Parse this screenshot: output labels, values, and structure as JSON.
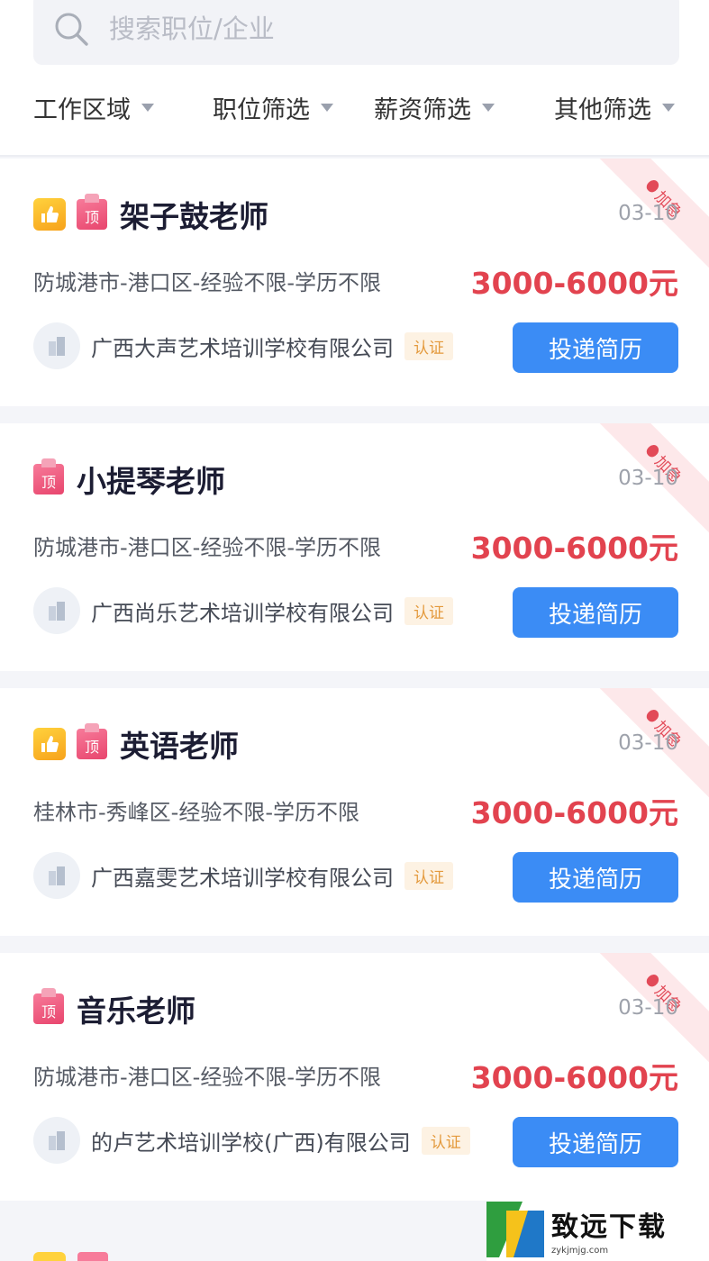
{
  "search": {
    "placeholder": "搜索职位/企业"
  },
  "filters": [
    {
      "label": "工作区域"
    },
    {
      "label": "职位筛选"
    },
    {
      "label": "薪资筛选"
    },
    {
      "label": "其他筛选"
    }
  ],
  "jobs": [
    {
      "title": "架子鼓老师",
      "date": "03-10",
      "location": "防城港市-港口区-经验不限-学历不限",
      "salary": "3000-6000元",
      "company": "广西大声艺术培训学校有限公司",
      "cert": "认证",
      "apply": "投递简历",
      "ribbon": "加急"
    },
    {
      "title": "小提琴老师",
      "date": "03-10",
      "location": "防城港市-港口区-经验不限-学历不限",
      "salary": "3000-6000元",
      "company": "广西尚乐艺术培训学校有限公司",
      "cert": "认证",
      "apply": "投递简历",
      "ribbon": "加急"
    },
    {
      "title": "英语老师",
      "date": "03-10",
      "location": "桂林市-秀峰区-经验不限-学历不限",
      "salary": "3000-6000元",
      "company": "广西嘉雯艺术培训学校有限公司",
      "cert": "认证",
      "apply": "投递简历",
      "ribbon": "加急"
    },
    {
      "title": "音乐老师",
      "date": "03-10",
      "location": "防城港市-港口区-经验不限-学历不限",
      "salary": "3000-6000元",
      "company": "的卢艺术培训学校(广西)有限公司",
      "cert": "认证",
      "apply": "投递简历",
      "ribbon": "加急"
    }
  ],
  "badges": {
    "top_label": "顶"
  },
  "colors": {
    "accent_blue": "#3b8cf5",
    "salary_red": "#e2434f",
    "cert_orange": "#e49a3d"
  },
  "watermark": {
    "title": "致远下载",
    "url": "zykjmjg.com"
  }
}
